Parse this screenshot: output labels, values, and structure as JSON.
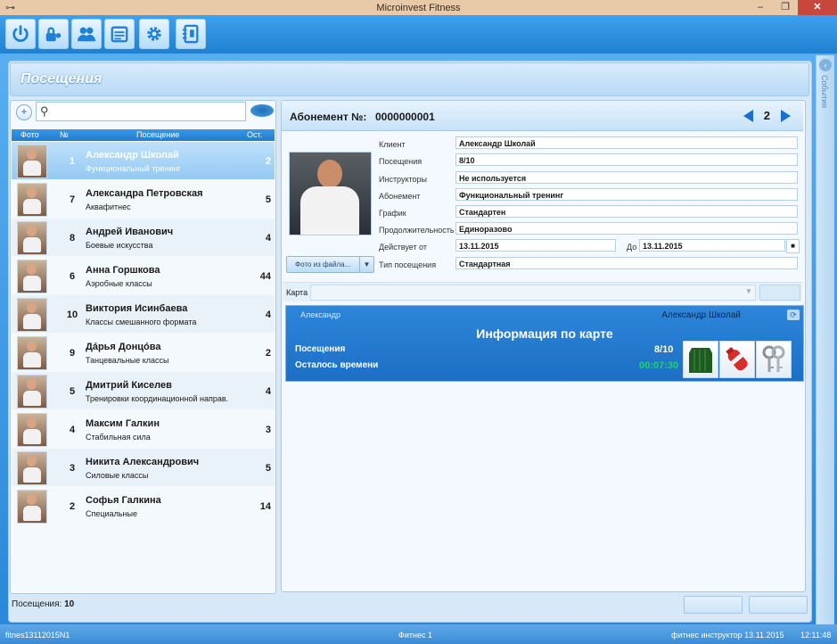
{
  "window": {
    "title": "Microinvest Fitness"
  },
  "page": {
    "title": "Посещения"
  },
  "events_label": "События",
  "list": {
    "headers": {
      "photo": "Фото",
      "num": "№",
      "visit": "Посещение",
      "remain": "Ост."
    },
    "items": [
      {
        "num": "1",
        "name": "Александр Школай",
        "desc": "Функциональный тренинг",
        "remain": "2",
        "selected": true
      },
      {
        "num": "7",
        "name": "Александра Петровская",
        "desc": "Аквафитнес",
        "remain": "5"
      },
      {
        "num": "8",
        "name": "Андрей Иванович",
        "desc": "Боевые искусства",
        "remain": "4"
      },
      {
        "num": "6",
        "name": "Анна Горшкова",
        "desc": "Аэробные классы",
        "remain": "44"
      },
      {
        "num": "10",
        "name": "Виктория Исинбаева",
        "desc": "Классы смешанного формата",
        "remain": "4"
      },
      {
        "num": "9",
        "name": "Дáрья Донцóва",
        "desc": "Танцевальные классы",
        "remain": "2"
      },
      {
        "num": "5",
        "name": "Дмитрий Киселев",
        "desc": "Тренировки координационной направ.",
        "remain": "4"
      },
      {
        "num": "4",
        "name": "Максим Галкин",
        "desc": "Стабильная сила",
        "remain": "3"
      },
      {
        "num": "3",
        "name": "Никита Александрович",
        "desc": "Силовые классы",
        "remain": "5"
      },
      {
        "num": "2",
        "name": "Софья Галкина",
        "desc": "Специальные",
        "remain": "14"
      }
    ]
  },
  "visits_count": {
    "label": "Посещения:",
    "value": "10"
  },
  "subscription": {
    "label": "Абонемент №:",
    "number": "0000000001",
    "page": "2"
  },
  "photo_button": "Фото из файла...",
  "fields": {
    "client": {
      "label": "Клиент",
      "value": "Александр Школай"
    },
    "visits": {
      "label": "Посещения",
      "value": "8/10"
    },
    "instructors": {
      "label": "Инструкторы",
      "value": "Не используется"
    },
    "subscription": {
      "label": "Абонемент",
      "value": "Функциональный тренинг"
    },
    "schedule": {
      "label": "График",
      "value": "Стандартен"
    },
    "duration": {
      "label": "Продолжительность",
      "value": "Единоразово"
    },
    "valid_from": {
      "label": "Действует от",
      "value": "13.11.2015"
    },
    "valid_to": {
      "label": "До",
      "value": "13.11.2015"
    },
    "visit_type": {
      "label": "Тип посещения",
      "value": "Стандартная"
    }
  },
  "card": {
    "label": "Карта",
    "holder_left": "Александр",
    "holder_right": "Александр Школай",
    "title": "Информация по карте",
    "visits_label": "Посещения",
    "visits_value": "8/10",
    "remaining_label": "Осталось времени",
    "remaining_value": "00:07:30"
  },
  "status": {
    "left": "fitnes13112015N1",
    "center": "Фитнес 1",
    "right": "фитнес инструктор 13.11.2015",
    "time": "12:11:48"
  },
  "colors": {
    "accent": "#1f7fd2",
    "time_green": "#1bd46a"
  }
}
